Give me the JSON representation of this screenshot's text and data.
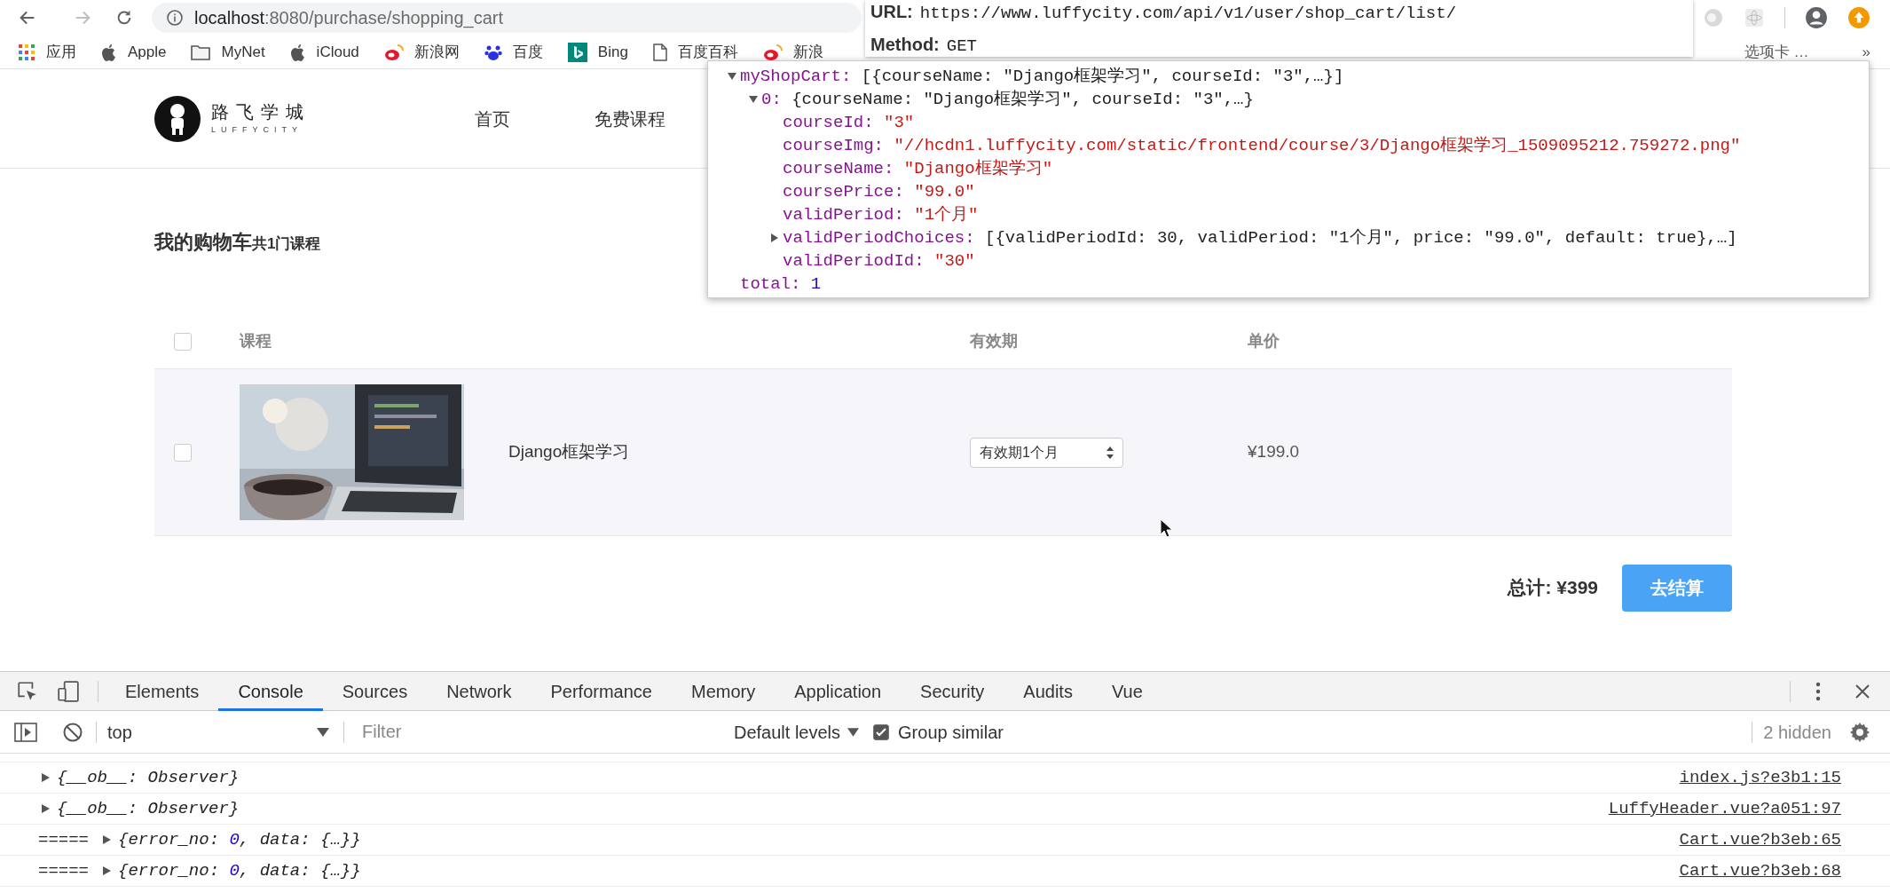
{
  "browser": {
    "url_host": "localhost",
    "url_path": ":8080/purchase/shopping_cart"
  },
  "bookmarks": [
    {
      "label": "应用",
      "kind": "apps"
    },
    {
      "label": "Apple",
      "kind": "apple"
    },
    {
      "label": "MyNet",
      "kind": "folder"
    },
    {
      "label": "iCloud",
      "kind": "apple"
    },
    {
      "label": "新浪网",
      "kind": "weibo"
    },
    {
      "label": "百度",
      "kind": "paw"
    },
    {
      "label": "Bing",
      "kind": "bing"
    },
    {
      "label": "百度百科",
      "kind": "page"
    },
    {
      "label": "新浪",
      "kind": "weibo"
    }
  ],
  "bookmarks_more": {
    "label": "选项卡 …",
    "chevron": "»"
  },
  "request_popup": {
    "url_label": "URL:",
    "url": "https://www.luffycity.com/api/v1/user/shop_cart/list/",
    "method_label": "Method:",
    "method": "GET"
  },
  "json_preview": [
    {
      "key": "myShopCart:",
      "value": "[{courseName: \"Django框架学习\", courseId: \"3\",…}]",
      "kind": "preview",
      "expanded": true,
      "children": [
        {
          "key": "0:",
          "value": "{courseName: \"Django框架学习\", courseId: \"3\",…}",
          "kind": "preview",
          "expanded": true,
          "children": [
            {
              "key": "courseId:",
              "value": "\"3\"",
              "kind": "string"
            },
            {
              "key": "courseImg:",
              "value": "\"//hcdn1.luffycity.com/static/frontend/course/3/Django框架学习_1509095212.759272.png\"",
              "kind": "string"
            },
            {
              "key": "courseName:",
              "value": "\"Django框架学习\"",
              "kind": "string"
            },
            {
              "key": "coursePrice:",
              "value": "\"99.0\"",
              "kind": "string"
            },
            {
              "key": "validPeriod:",
              "value": "\"1个月\"",
              "kind": "string"
            },
            {
              "key": "validPeriodChoices:",
              "value": "[{validPeriodId: 30, validPeriod: \"1个月\", price: \"99.0\", default: true},…]",
              "kind": "preview",
              "expanded": false
            },
            {
              "key": "validPeriodId:",
              "value": "\"30\"",
              "kind": "string"
            }
          ]
        }
      ]
    },
    {
      "key": "total:",
      "value": "1",
      "kind": "number"
    }
  ],
  "site": {
    "logo_title": "路飞学城",
    "logo_subtitle": "LUFFYCITY",
    "nav": [
      "首页",
      "免费课程"
    ]
  },
  "cart": {
    "title": "我的购物车",
    "subtitle": "共1门课程",
    "select_all_checked": false,
    "columns": [
      "课程",
      "有效期",
      "单价"
    ],
    "rows": [
      {
        "checked": false,
        "name": "Django框架学习",
        "period": "有效期1个月",
        "price": "¥199.0"
      }
    ],
    "total": "总计: ¥399",
    "checkout": "去结算"
  },
  "devtools": {
    "tabs": [
      {
        "label": "Elements",
        "selected": false
      },
      {
        "label": "Console",
        "selected": true
      },
      {
        "label": "Sources",
        "selected": false
      },
      {
        "label": "Network",
        "selected": false
      },
      {
        "label": "Performance",
        "selected": false
      },
      {
        "label": "Memory",
        "selected": false
      },
      {
        "label": "Application",
        "selected": false
      },
      {
        "label": "Security",
        "selected": false
      },
      {
        "label": "Audits",
        "selected": false
      },
      {
        "label": "Vue",
        "selected": false
      }
    ],
    "context": "top",
    "filter_placeholder": "Filter",
    "levels": "Default levels",
    "group_similar": {
      "label": "Group similar",
      "checked": true
    },
    "hidden": "2 hidden",
    "messages": [
      {
        "parts": [
          {
            "text": "{__ob__: Observer}",
            "kind": "plain"
          }
        ],
        "source": "index.js?e3b1:15"
      },
      {
        "parts": [
          {
            "text": "{__ob__: Observer}",
            "kind": "plain"
          }
        ],
        "source": "LuffyHeader.vue?a051:97"
      },
      {
        "prefix": "=====",
        "parts": [
          {
            "text": "{error_no: ",
            "kind": "plain"
          },
          {
            "text": "0",
            "kind": "number"
          },
          {
            "text": ", data: {…}}",
            "kind": "plain"
          }
        ],
        "source": "Cart.vue?b3eb:65"
      },
      {
        "prefix": "=====",
        "parts": [
          {
            "text": "{error_no: ",
            "kind": "plain"
          },
          {
            "text": "0",
            "kind": "number"
          },
          {
            "text": ", data: {…}}",
            "kind": "plain"
          }
        ],
        "source": "Cart.vue?b3eb:68"
      }
    ]
  }
}
